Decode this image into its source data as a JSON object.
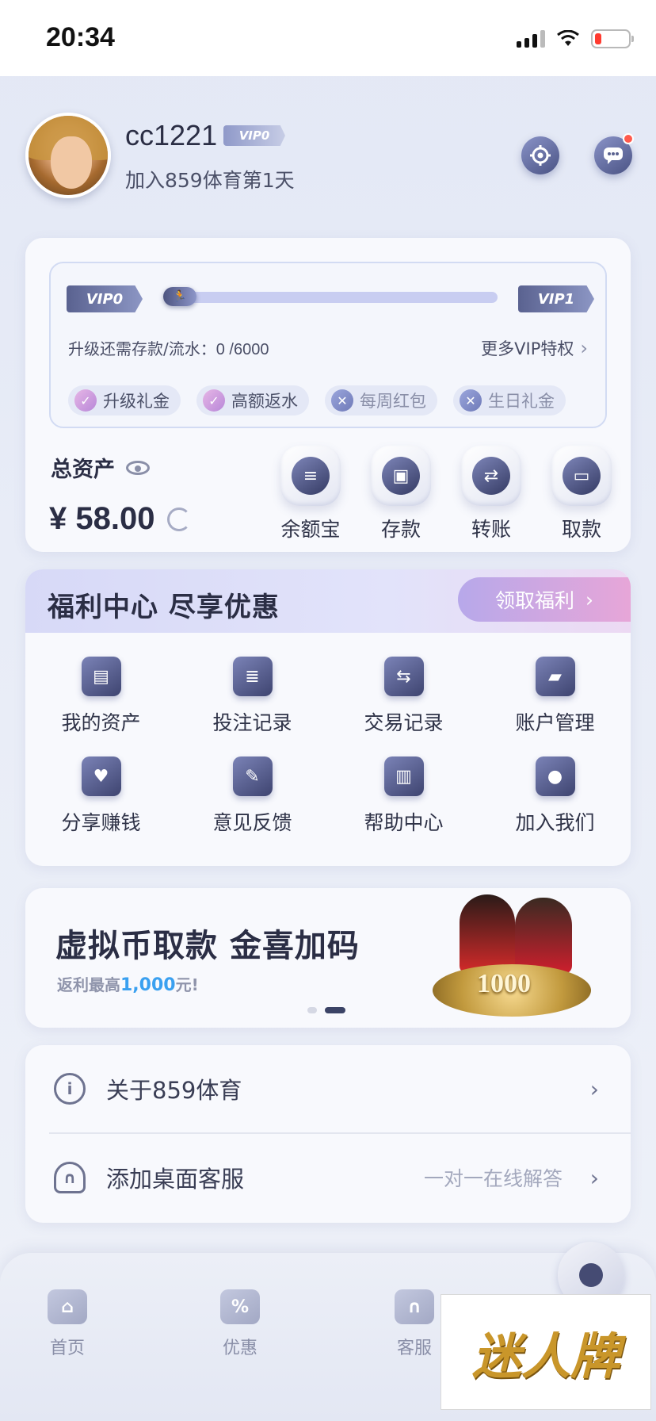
{
  "status_bar": {
    "time": "20:34"
  },
  "profile": {
    "username": "cc1221",
    "vip_badge": "VIP0",
    "join_text": "加入859体育第1天"
  },
  "vip": {
    "current_level": "VIP0",
    "next_level": "VIP1",
    "progress_fraction": 0,
    "upgrade_label": "升级还需存款/流水：",
    "upgrade_value": "0 /6000",
    "more_label": "更多VIP特权",
    "perks": [
      {
        "label": "升级礼金",
        "status": "check"
      },
      {
        "label": "高额返水",
        "status": "check"
      },
      {
        "label": "每周红包",
        "status": "cross"
      },
      {
        "label": "生日礼金",
        "status": "cross"
      }
    ]
  },
  "assets": {
    "label": "总资产",
    "balance": "¥ 58.00",
    "actions": [
      {
        "label": "余额宝",
        "icon": "coin-stack-icon"
      },
      {
        "label": "存款",
        "icon": "wallet-icon"
      },
      {
        "label": "转账",
        "icon": "transfer-icon"
      },
      {
        "label": "取款",
        "icon": "card-icon"
      }
    ]
  },
  "welfare": {
    "title": "福利中心 尽享优惠",
    "claim_label": "领取福利",
    "items": [
      {
        "label": "我的资产",
        "icon": "wallet-icon"
      },
      {
        "label": "投注记录",
        "icon": "document-icon"
      },
      {
        "label": "交易记录",
        "icon": "exchange-icon"
      },
      {
        "label": "账户管理",
        "icon": "folder-icon"
      },
      {
        "label": "分享赚钱",
        "icon": "handshake-icon"
      },
      {
        "label": "意见反馈",
        "icon": "edit-icon"
      },
      {
        "label": "帮助中心",
        "icon": "book-icon"
      },
      {
        "label": "加入我们",
        "icon": "users-icon"
      }
    ]
  },
  "promo": {
    "title": "虚拟币取款 金喜加码",
    "subtitle_prefix": "返利最高",
    "subtitle_amount": "1,000",
    "subtitle_suffix": "元!",
    "art_text": "1000",
    "active_dot": 1
  },
  "links": {
    "about": {
      "label": "关于859体育"
    },
    "service": {
      "label": "添加桌面客服",
      "hint": "一对一在线解答"
    }
  },
  "bottom_nav": {
    "items": [
      {
        "label": "首页"
      },
      {
        "label": "优惠"
      },
      {
        "label": "客服"
      }
    ]
  },
  "watermark": {
    "text": "迷人牌"
  },
  "colors": {
    "accent": "#3b4366",
    "promo_amount": "#3aa0f0",
    "notification_dot": "#ff5a4d"
  }
}
